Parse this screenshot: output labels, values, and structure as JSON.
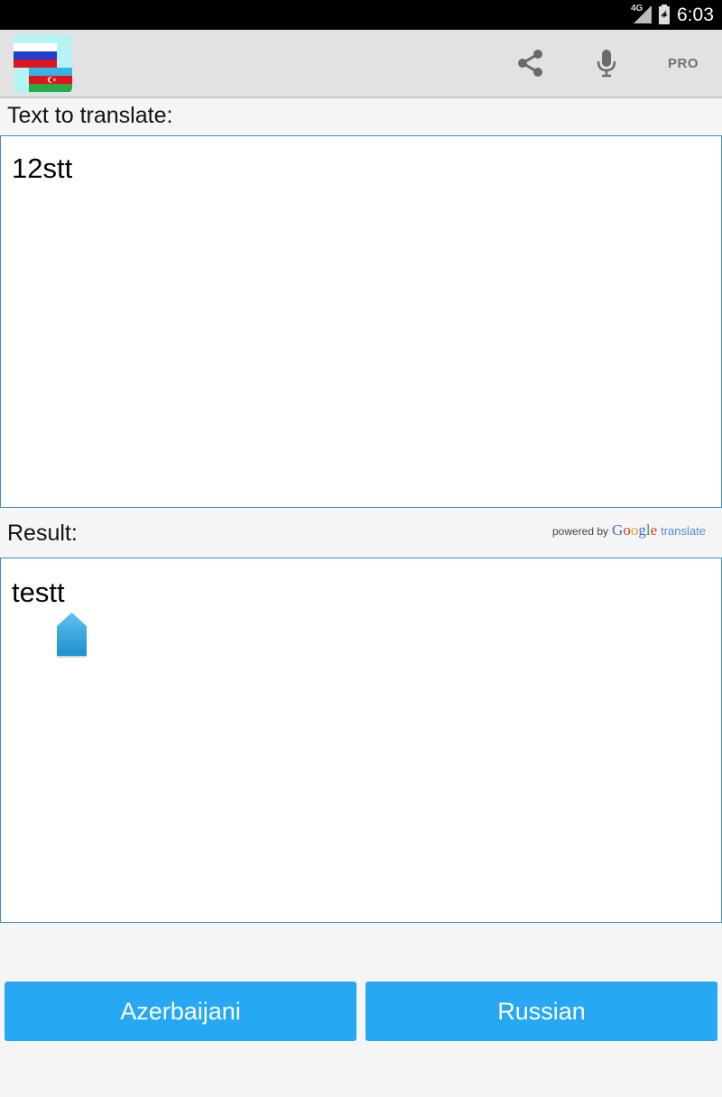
{
  "status_bar": {
    "network": "4G",
    "time": "6:03"
  },
  "action_bar": {
    "app_icon": "russian-azerbaijani-flags-icon",
    "share_icon": "share-icon",
    "mic_icon": "microphone-icon",
    "pro_label": "PRO"
  },
  "input": {
    "label": "Text to translate:",
    "value": "12stt"
  },
  "result": {
    "label": "Result:",
    "value": "testt",
    "powered_by": "powered by",
    "google_letters": [
      "G",
      "o",
      "o",
      "g",
      "l",
      "e"
    ],
    "translate_word": "translate"
  },
  "buttons": {
    "source_language": "Azerbaijani",
    "target_language": "Russian"
  },
  "colors": {
    "accent": "#27a8f5",
    "field_border": "#3a8ed6",
    "action_bar": "#e2e2e2"
  }
}
